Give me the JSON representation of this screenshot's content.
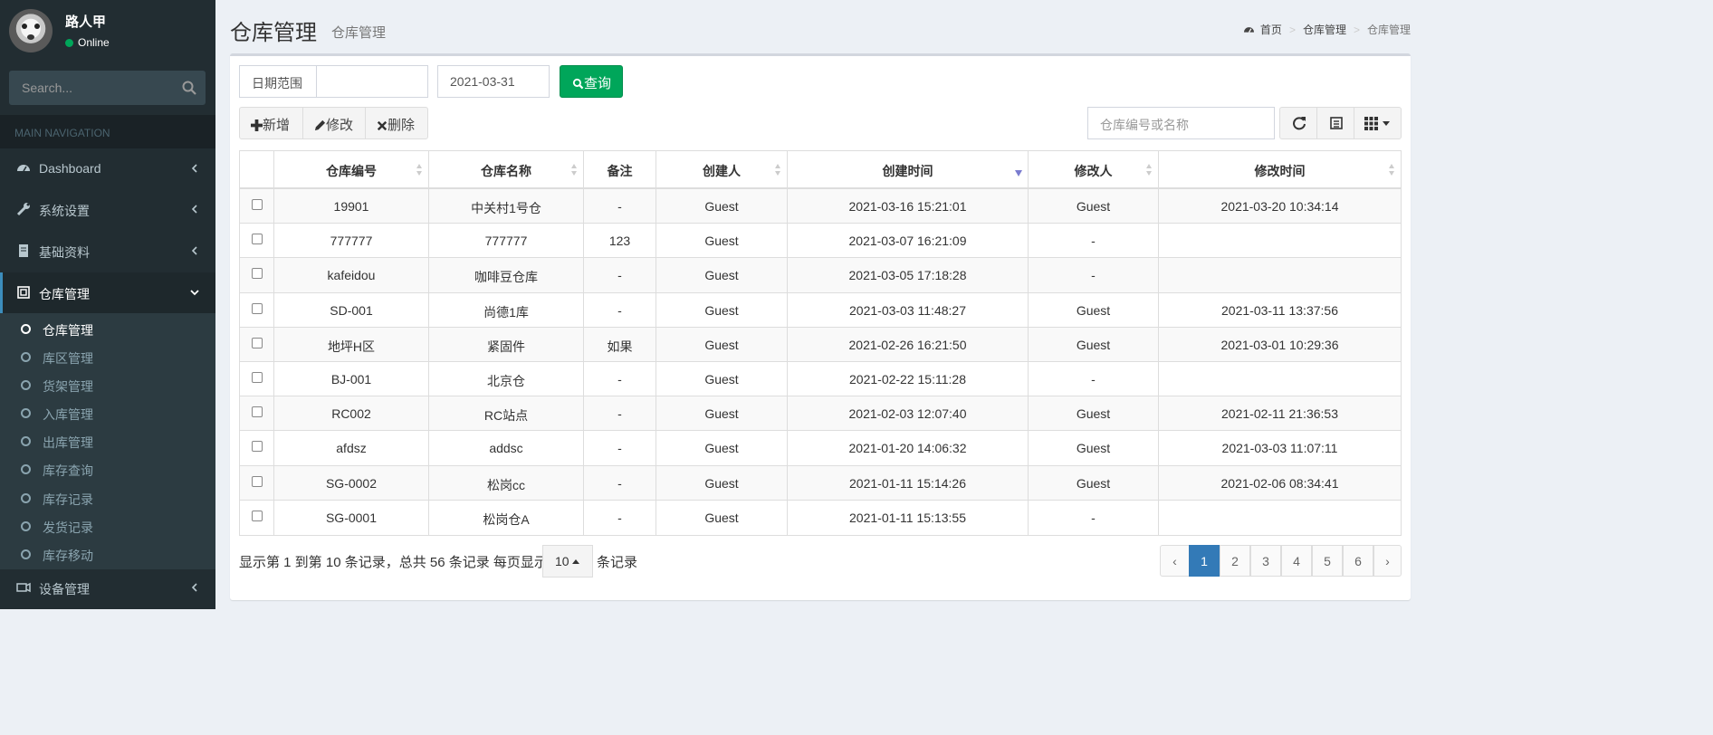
{
  "user": {
    "name": "路人甲",
    "status": "Online"
  },
  "sidebar": {
    "search_placeholder": "Search...",
    "nav_header": "MAIN NAVIGATION",
    "items": [
      {
        "label": "Dashboard",
        "icon": "dashboard-icon"
      },
      {
        "label": "系统设置",
        "icon": "wrench-icon"
      },
      {
        "label": "基础资料",
        "icon": "book-icon"
      },
      {
        "label": "仓库管理",
        "icon": "warehouse-icon"
      },
      {
        "label": "设备管理",
        "icon": "device-icon"
      }
    ],
    "submenu": [
      "仓库管理",
      "库区管理",
      "货架管理",
      "入库管理",
      "出库管理",
      "库存查询",
      "库存记录",
      "发货记录",
      "库存移动"
    ]
  },
  "header": {
    "title": "仓库管理",
    "subtitle": "仓库管理"
  },
  "breadcrumb": {
    "home": "首页",
    "parent": "仓库管理",
    "current": "仓库管理"
  },
  "filters": {
    "date_label": "日期范围",
    "date_start": "",
    "date_end": "2021-03-31",
    "query_label": "查询"
  },
  "toolbar": {
    "add": "新增",
    "edit": "修改",
    "delete": "删除",
    "search_placeholder": "仓库编号或名称"
  },
  "table": {
    "columns": [
      "仓库编号",
      "仓库名称",
      "备注",
      "创建人",
      "创建时间",
      "修改人",
      "修改时间"
    ],
    "rows": [
      [
        "19901",
        "中关村1号仓",
        "-",
        "Guest",
        "2021-03-16 15:21:01",
        "Guest",
        "2021-03-20 10:34:14"
      ],
      [
        "777777",
        "777777",
        "123",
        "Guest",
        "2021-03-07 16:21:09",
        "-",
        ""
      ],
      [
        "kafeidou",
        "咖啡豆仓库",
        "-",
        "Guest",
        "2021-03-05 17:18:28",
        "-",
        ""
      ],
      [
        "SD-001",
        "尚德1库",
        "-",
        "Guest",
        "2021-03-03 11:48:27",
        "Guest",
        "2021-03-11 13:37:56"
      ],
      [
        "地坪H区",
        "紧固件",
        "如果",
        "Guest",
        "2021-02-26 16:21:50",
        "Guest",
        "2021-03-01 10:29:36"
      ],
      [
        "BJ-001",
        "北京仓",
        "-",
        "Guest",
        "2021-02-22 15:11:28",
        "-",
        ""
      ],
      [
        "RC002",
        "RC站点",
        "-",
        "Guest",
        "2021-02-03 12:07:40",
        "Guest",
        "2021-02-11 21:36:53"
      ],
      [
        "afdsz",
        "addsc",
        "-",
        "Guest",
        "2021-01-20 14:06:32",
        "Guest",
        "2021-03-03 11:07:11"
      ],
      [
        "SG-0002",
        "松岗cc",
        "-",
        "Guest",
        "2021-01-11 15:14:26",
        "Guest",
        "2021-02-06 08:34:41"
      ],
      [
        "SG-0001",
        "松岗仓A",
        "-",
        "Guest",
        "2021-01-11 15:13:55",
        "-",
        ""
      ]
    ]
  },
  "pagination": {
    "info": "显示第 1 到第 10 条记录，总共 56 条记录 每页显示",
    "page_size": "10",
    "suffix": "条记录",
    "prev": "‹",
    "pages": [
      "1",
      "2",
      "3",
      "4",
      "5",
      "6"
    ],
    "next": "›",
    "current_page": "1"
  },
  "colors": {
    "sidebar_bg": "#222d32",
    "accent": "#3c8dbc",
    "success": "#00a65a",
    "page_active": "#337ab7"
  }
}
